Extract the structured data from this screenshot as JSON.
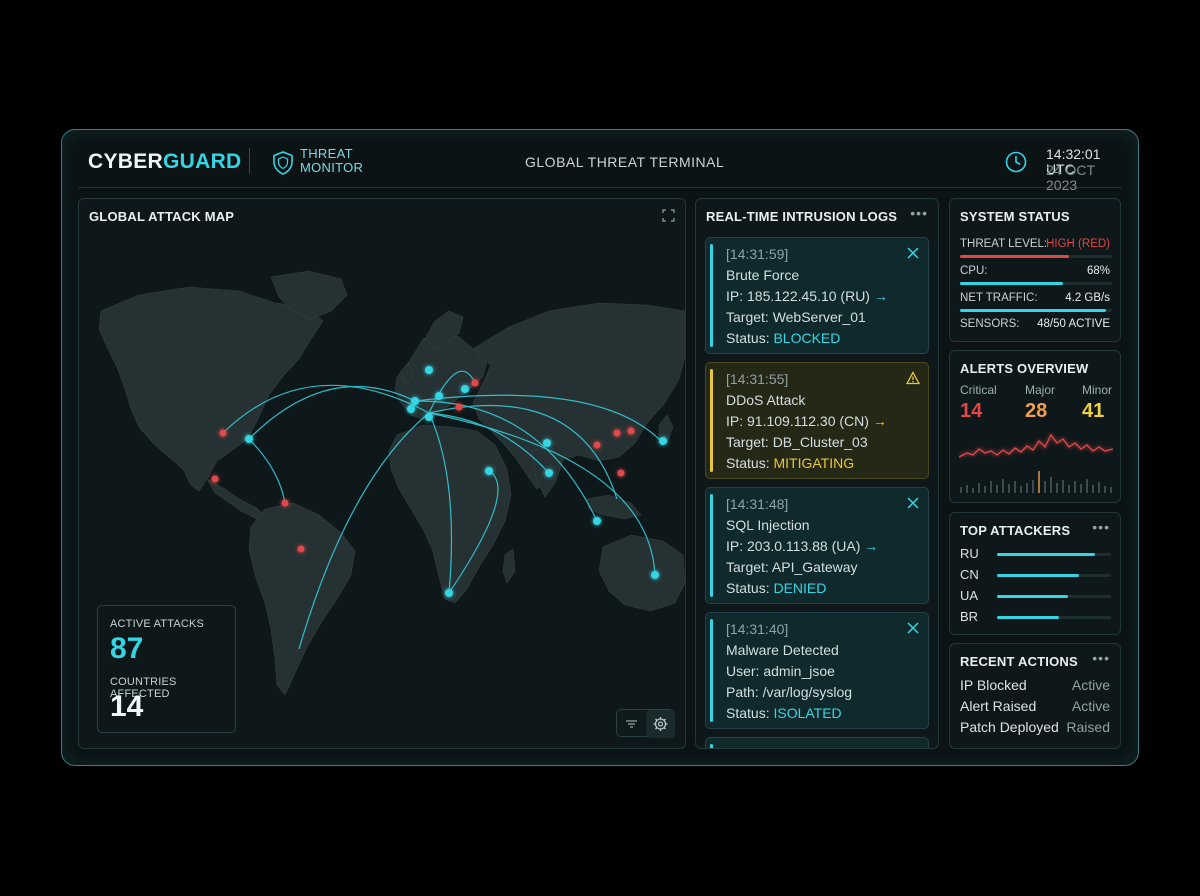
{
  "header": {
    "brand_main": "CYBER",
    "brand_accent": "GUARD",
    "subtitle_line1": "THREAT",
    "subtitle_line2": "MONITOR",
    "title": "GLOBAL THREAT TERMINAL",
    "time": "14:32:01 UTC",
    "date": "24 OCT 2023"
  },
  "map": {
    "title": "GLOBAL ATTACK MAP",
    "active_attacks_label": "ACTIVE ATTACKS",
    "active_attacks_value": "87",
    "countries_label": "COUNTRIES AFFECTED",
    "countries_value": "14"
  },
  "logs": {
    "title": "REAL-TIME INTRUSION LOGS",
    "entries": [
      {
        "time": "[14:31:59]",
        "type": "Brute Force",
        "line2": "IP: 185.122.45.10 (RU)",
        "line3": "Target: WebServer_01",
        "status_prefix": "Status: ",
        "status": "BLOCKED",
        "icon": "close-icon",
        "level": "info"
      },
      {
        "time": "[14:31:55]",
        "type": "DDoS Attack",
        "line2": "IP: 91.109.112.30 (CN)",
        "line3": "Target: DB_Cluster_03",
        "status_prefix": "Status: ",
        "status": "MITIGATING",
        "icon": "warning-icon",
        "level": "warning"
      },
      {
        "time": "[14:31:48]",
        "type": "SQL Injection",
        "line2": "IP: 203.0.113.88 (UA)",
        "line3": "Target: API_Gateway",
        "status_prefix": "Status: ",
        "status": "DENIED",
        "icon": "close-icon",
        "level": "info"
      },
      {
        "time": "[14:31:40]",
        "type": "Malware Detected",
        "line2": "User: admin_jsoe",
        "line3": "Path: /var/log/syslog",
        "status_prefix": "Status: ",
        "status": "ISOLATED",
        "icon": "close-icon",
        "level": "info"
      }
    ]
  },
  "system_status": {
    "title": "SYSTEM STATUS",
    "threat_label": "THREAT LEVEL:",
    "threat_value": "HIGH (RED)",
    "threat_level": 0.72,
    "cpu_label": "CPU:",
    "cpu_value": "68%",
    "cpu_level": 0.68,
    "net_label": "NET TRAFFIC:",
    "net_value": "4.2 GB/s",
    "net_level": 0.96,
    "sensors_label": "SENSORS:",
    "sensors_value": "48/50 ACTIVE"
  },
  "alerts": {
    "title": "ALERTS OVERVIEW",
    "critical_label": "Critical",
    "critical_value": "14",
    "major_label": "Major",
    "major_value": "28",
    "minor_label": "Minor",
    "minor_value": "41"
  },
  "top_attackers": {
    "title": "TOP ATTACKERS",
    "items": [
      {
        "code": "RU",
        "level": 0.86
      },
      {
        "code": "CN",
        "level": 0.72
      },
      {
        "code": "UA",
        "level": 0.62
      },
      {
        "code": "BR",
        "level": 0.54
      }
    ]
  },
  "recent_actions": {
    "title": "RECENT ACTIONS",
    "items": [
      {
        "label": "IP Blocked",
        "state": "Active"
      },
      {
        "label": "Alert Raised",
        "state": "Active"
      },
      {
        "label": "Patch Deployed",
        "state": "Raised"
      }
    ]
  },
  "colors": {
    "accent": "#35d6e4",
    "critical": "#e04848",
    "major": "#f0a050",
    "minor": "#f0d040",
    "warning": "#e6c73a"
  }
}
